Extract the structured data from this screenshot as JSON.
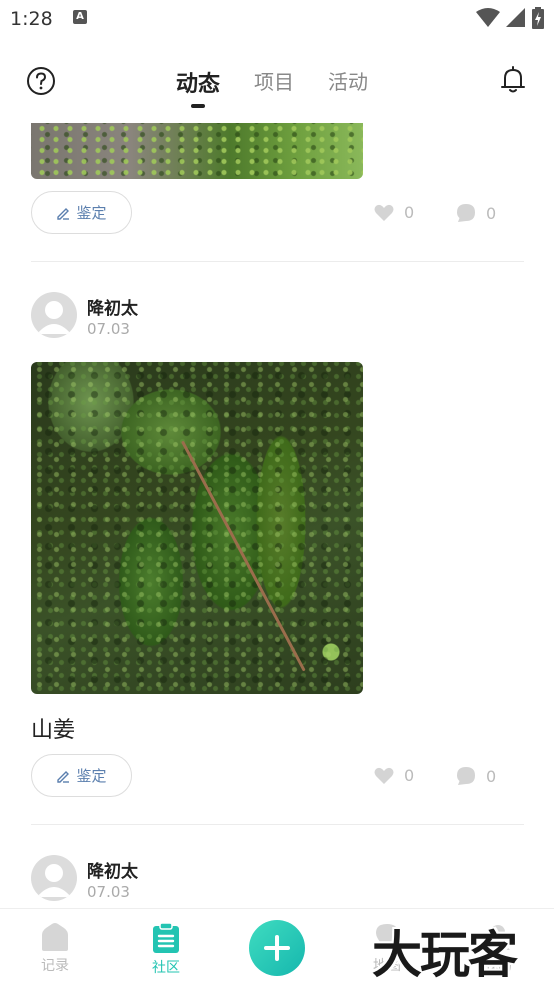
{
  "status_bar": {
    "time": "1:28",
    "notification_badge": "A"
  },
  "header": {
    "tabs": [
      {
        "label": "动态",
        "active": true
      },
      {
        "label": "项目",
        "active": false
      },
      {
        "label": "活动",
        "active": false
      }
    ]
  },
  "feed": {
    "post_top": {
      "appraise_label": "鉴定",
      "likes": "0",
      "comments": "0"
    },
    "post_main": {
      "username": "降初太",
      "date": "07.03",
      "caption": "山姜",
      "appraise_label": "鉴定",
      "likes": "0",
      "comments": "0"
    },
    "post_next": {
      "username": "降初太",
      "date": "07.03"
    }
  },
  "bottom_nav": {
    "items": [
      {
        "label": "记录",
        "icon": "home-icon",
        "active": false
      },
      {
        "label": "社区",
        "icon": "clipboard-icon",
        "active": true
      },
      {
        "label": "地图",
        "icon": "map-icon",
        "active": false
      },
      {
        "label": "我的",
        "icon": "user-icon",
        "active": false
      }
    ]
  },
  "watermark": "大玩客",
  "colors": {
    "accent": "#23c4b2",
    "link": "#5b7fae"
  }
}
